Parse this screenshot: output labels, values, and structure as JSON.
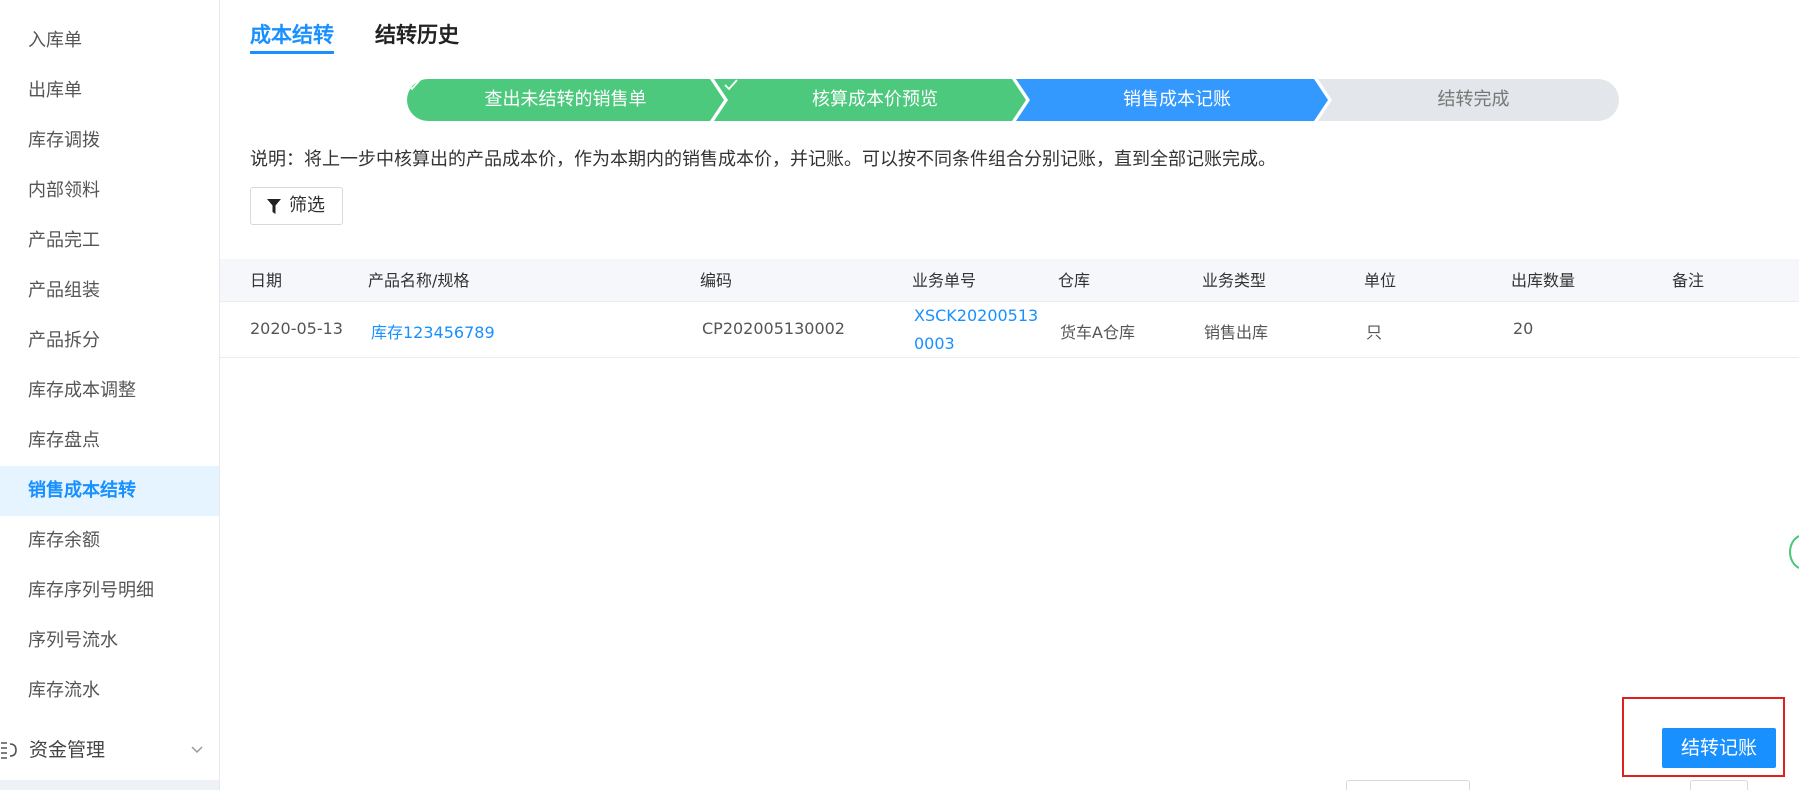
{
  "sidebar": {
    "items": [
      {
        "label": "入库单"
      },
      {
        "label": "出库单"
      },
      {
        "label": "库存调拨"
      },
      {
        "label": "内部领料"
      },
      {
        "label": "产品完工"
      },
      {
        "label": "产品组装"
      },
      {
        "label": "产品拆分"
      },
      {
        "label": "库存成本调整"
      },
      {
        "label": "库存盘点"
      },
      {
        "label": "销售成本结转",
        "active": true
      },
      {
        "label": "库存余额"
      },
      {
        "label": "库存序列号明细"
      },
      {
        "label": "序列号流水"
      },
      {
        "label": "库存流水"
      }
    ],
    "group": {
      "label": "资金管理",
      "icon": "funds-icon"
    }
  },
  "tabs": [
    {
      "label": "成本结转",
      "active": true
    },
    {
      "label": "结转历史",
      "active": false
    }
  ],
  "steps": [
    {
      "label": "查出未结转的销售单",
      "status": "done"
    },
    {
      "label": "核算成本价预览",
      "status": "done"
    },
    {
      "label": "销售成本记账",
      "status": "current"
    },
    {
      "label": "结转完成",
      "status": "pending"
    }
  ],
  "colors": {
    "step_done": "#4cc97d",
    "step_current": "#3399ff",
    "step_pending": "#e3e6ea",
    "accent": "#1890ff",
    "highlight": "#e02020"
  },
  "description": "说明：将上一步中核算出的产品成本价，作为本期内的销售成本价，并记账。可以按不同条件组合分别记账，直到全部记账完成。",
  "filter_button": {
    "label": "筛选",
    "icon": "filter-icon"
  },
  "table": {
    "columns": [
      "日期",
      "产品名称/规格",
      "编码",
      "业务单号",
      "仓库",
      "业务类型",
      "单位",
      "出库数量",
      "备注"
    ],
    "rows": [
      {
        "date": "2020-05-13",
        "product": "库存123456789",
        "code": "CP202005130002",
        "order_no": "XSCK202005130003",
        "warehouse": "货车A仓库",
        "biz_type": "销售出库",
        "unit": "只",
        "qty": "20",
        "remark": ""
      }
    ]
  },
  "action_button": {
    "label": "结转记账"
  }
}
